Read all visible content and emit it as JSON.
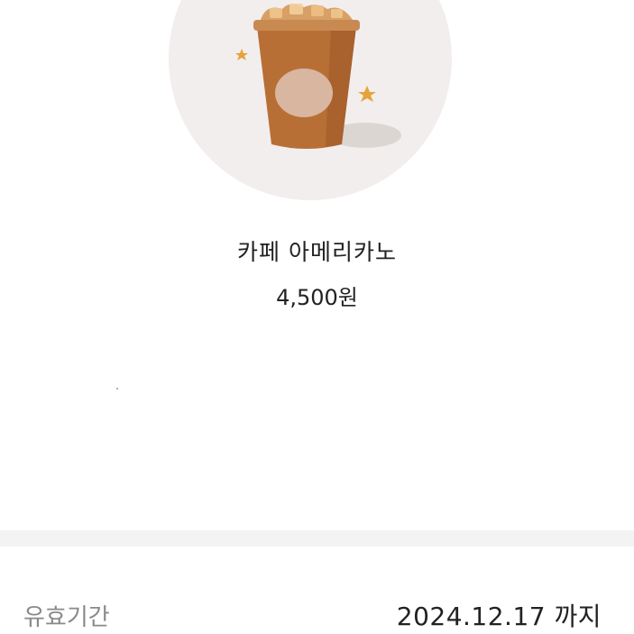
{
  "product": {
    "name": "카페 아메리카노",
    "price": "4,500원",
    "image_icon": "iced-coffee-cup-icon"
  },
  "info": {
    "validity_label": "유효기간",
    "validity_value": "2024.12.17 까지"
  },
  "colors": {
    "circle_bg": "#f2eeee",
    "coffee": "#b8703a",
    "star": "#e6a23c",
    "text": "#222222",
    "muted_text": "#8a8a8a",
    "divider": "#f3f3f3"
  }
}
